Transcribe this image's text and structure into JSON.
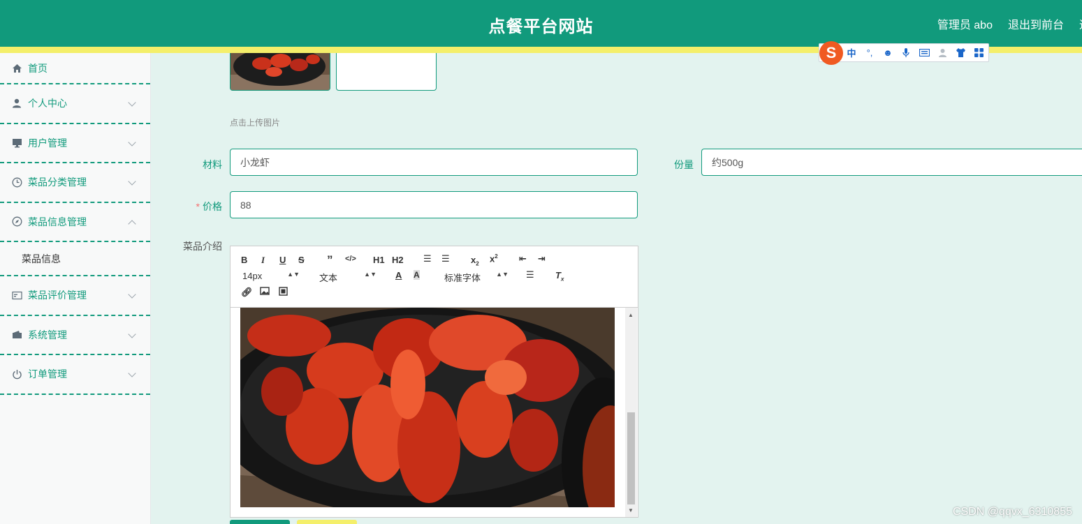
{
  "header": {
    "title": "点餐平台网站",
    "user": "管理员 abo",
    "logout": "退出到前台",
    "clipped": "退"
  },
  "ime": {
    "logo": "S",
    "mode": "中",
    "punct": "°,"
  },
  "sidebar": {
    "items": [
      {
        "label": "首页",
        "icon": "home-icon"
      },
      {
        "label": "个人中心",
        "icon": "user-icon"
      },
      {
        "label": "用户管理",
        "icon": "monitor-icon"
      },
      {
        "label": "菜品分类管理",
        "icon": "clock-icon"
      },
      {
        "label": "菜品信息管理",
        "icon": "compass-icon"
      },
      {
        "label": "菜品评价管理",
        "icon": "card-icon"
      },
      {
        "label": "系统管理",
        "icon": "wallet-icon"
      },
      {
        "label": "订单管理",
        "icon": "power-icon"
      }
    ],
    "submenu": "菜品信息"
  },
  "form": {
    "upload_hint": "点击上传图片",
    "material_label": "材料",
    "material_value": "小龙虾",
    "portion_label": "份量",
    "portion_value": "约500g",
    "price_required": "*",
    "price_label": "价格",
    "price_value": "88",
    "intro_label": "菜品介绍"
  },
  "editor": {
    "font_size": "14px",
    "text_type": "文本",
    "font_family": "标准字体",
    "h1": "H1",
    "h2": "H2"
  },
  "watermark": "CSDN @qqvx_6310855",
  "colors": {
    "primary": "#119a7c",
    "accent": "#f4ef6a",
    "background": "#e3f3ef"
  }
}
